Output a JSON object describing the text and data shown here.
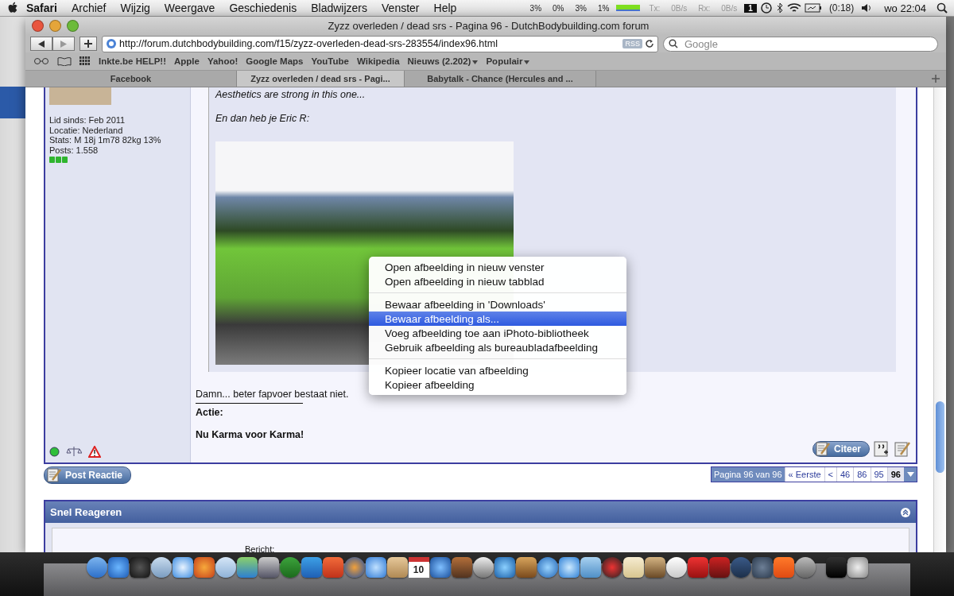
{
  "menubar": {
    "app": "Safari",
    "items": [
      "Archief",
      "Wijzig",
      "Weergave",
      "Geschiedenis",
      "Bladwijzers",
      "Venster",
      "Help"
    ],
    "cpu": [
      "3%",
      "0%",
      "3%",
      "1%"
    ],
    "net": [
      "Tx:",
      "0B/s",
      "Rx:",
      "0B/s"
    ],
    "spaces": "1",
    "battery": "(0:18)",
    "clock": "wo 22:04"
  },
  "window": {
    "title": "Zyzz overleden / dead srs - Pagina 96 - DutchBodybuilding.com forum",
    "address": "http://forum.dutchbodybuilding.com/f15/zyzz-overleden-dead-srs-283554/index96.html",
    "rss": "RSS",
    "search": {
      "placeholder": "Google"
    },
    "bookmarks": [
      {
        "label": "Inkte.be HELP!!",
        "kind": "link"
      },
      {
        "label": "Apple",
        "kind": "link"
      },
      {
        "label": "Yahoo!",
        "kind": "link"
      },
      {
        "label": "Google Maps",
        "kind": "link"
      },
      {
        "label": "YouTube",
        "kind": "link"
      },
      {
        "label": "Wikipedia",
        "kind": "link"
      },
      {
        "label": "Nieuws (2.202)",
        "kind": "menu"
      },
      {
        "label": "Populair",
        "kind": "menu"
      }
    ],
    "tabs": [
      {
        "label": "Facebook",
        "selected": false
      },
      {
        "label": "Zyzz overleden / dead srs - Pagi...",
        "selected": true
      },
      {
        "label": "Babytalk - Chance (Hercules and ...",
        "selected": false
      }
    ]
  },
  "post": {
    "user_info": [
      "Lid sinds: Feb 2011",
      "Locatie: Nederland",
      "Stats: M 18j 1m78 82kg 13%",
      "Posts: 1.558"
    ],
    "quote": [
      "Aesthetics are strong in this one...",
      "En dan heb je Eric R:"
    ],
    "body": "Damn... beter fapvoer bestaat niet.",
    "signature": [
      "Actie:",
      "Nu Karma voor Karma!"
    ],
    "quote_button": "Citeer"
  },
  "post_reply_button": "Post Reactie",
  "pagination": {
    "label": "Pagina 96 van 96",
    "links": [
      {
        "label": "« Eerste",
        "selected": false
      },
      {
        "label": "<",
        "selected": false
      },
      {
        "label": "46",
        "selected": false
      },
      {
        "label": "86",
        "selected": false
      },
      {
        "label": "95",
        "selected": false
      },
      {
        "label": "96",
        "selected": true
      }
    ]
  },
  "quick_reply": {
    "title": "Snel Reageren",
    "field_label": "Bericht:"
  },
  "context_menu": {
    "groups": [
      [
        {
          "label": "Open afbeelding in nieuw venster",
          "selected": false
        },
        {
          "label": "Open afbeelding in nieuw tabblad",
          "selected": false
        }
      ],
      [
        {
          "label": "Bewaar afbeelding in 'Downloads'",
          "selected": false
        },
        {
          "label": "Bewaar afbeelding als...",
          "selected": true
        },
        {
          "label": "Voeg afbeelding toe aan iPhoto-bibliotheek",
          "selected": false
        },
        {
          "label": "Gebruik afbeelding als bureaubladafbeelding",
          "selected": false
        }
      ],
      [
        {
          "label": "Kopieer locatie van afbeelding",
          "selected": false
        },
        {
          "label": "Kopieer afbeelding",
          "selected": false
        }
      ]
    ]
  },
  "dock": {
    "calendar_day": "10"
  }
}
